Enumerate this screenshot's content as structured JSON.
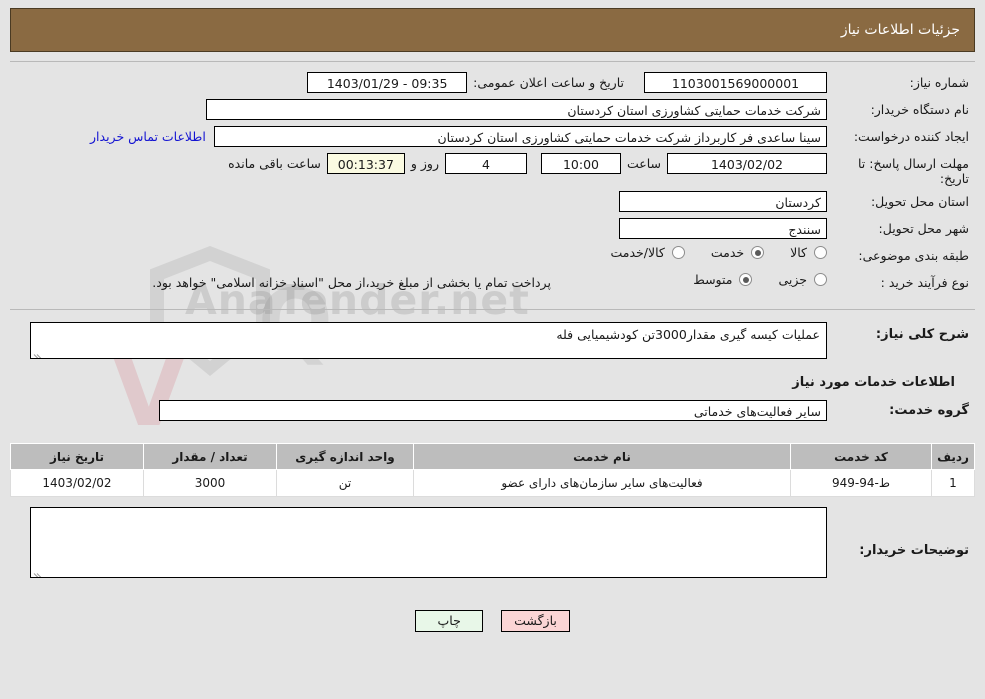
{
  "header": {
    "title": "جزئیات اطلاعات نیاز",
    "bg_color": "#8a6a42",
    "text_color": "#ffffff"
  },
  "watermark": {
    "text": "AnaTender.net",
    "mark_v": "V",
    "mark_q": "Q"
  },
  "basic_info": {
    "need_number_label": "شماره نیاز:",
    "need_number_value": "1103001569000001",
    "public_announce_label": "تاریخ و ساعت اعلان عمومی:",
    "public_announce_value": "09:35 - 1403/01/29",
    "buyer_org_label": "نام دستگاه خریدار:",
    "buyer_org_value": "شرکت خدمات حمایتی کشاورزی استان کردستان",
    "requester_label": "ایجاد کننده درخواست:",
    "requester_value": "سینا ساعدی فر کاربرداز شرکت خدمات حمایتی کشاورزی استان کردستان",
    "contact_link_label": "اطلاعات تماس خریدار",
    "contact_link_color": "#1414d2",
    "deadline_label": "مهلت ارسال پاسخ: تا تاریخ:",
    "deadline_date": "1403/02/02",
    "deadline_hour_label": "ساعت",
    "deadline_hour": "10:00",
    "remaining_days": "4",
    "remaining_days_suffix": "روز و",
    "remaining_time": "00:13:37",
    "remaining_time_suffix": "ساعت باقی مانده",
    "remaining_time_bg": "#fbfbe2",
    "province_label": "استان محل تحویل:",
    "province_value": "کردستان",
    "city_label": "شهر محل تحویل:",
    "city_value": "سنندج"
  },
  "classification": {
    "label": "طبقه بندی موضوعی:",
    "options": [
      {
        "label": "کالا",
        "selected": false
      },
      {
        "label": "خدمت",
        "selected": true
      },
      {
        "label": "کالا/خدمت",
        "selected": false
      }
    ]
  },
  "purchase_process": {
    "label": "نوع فرآیند خرید :",
    "options": [
      {
        "label": "جزیی",
        "selected": false
      },
      {
        "label": "متوسط",
        "selected": true
      }
    ],
    "note": "پرداخت تمام یا بخشی از مبلغ خرید،از محل \"اسناد خزانه اسلامی\" خواهد بود."
  },
  "general_description": {
    "label": "شرح کلی نیاز:",
    "value": "عملیات کیسه گیری مقدار3000تن کودشیمیایی فله"
  },
  "services_section": {
    "heading": "اطلاعات خدمات مورد نیاز",
    "group_label": "گروه خدمت:",
    "group_value": "سایر فعالیت‌های خدماتی"
  },
  "items_table": {
    "headers": {
      "index": "ردیف",
      "code": "کد خدمت",
      "name": "نام خدمت",
      "unit": "واحد اندازه گیری",
      "quantity": "تعداد / مقدار",
      "need_date": "تاریخ نیاز"
    },
    "rows": [
      {
        "index": "1",
        "code": "ط-94-949",
        "name": "فعالیت‌های سایر سازمان‌های دارای عضو",
        "unit": "تن",
        "quantity": "3000",
        "need_date": "1403/02/02"
      }
    ]
  },
  "buyer_notes": {
    "label": "توضیحات خریدار:",
    "value": ""
  },
  "buttons": {
    "print": "چاپ",
    "print_bg": "#e8f7e8",
    "back": "بازگشت",
    "back_bg": "#fbd5d5"
  }
}
